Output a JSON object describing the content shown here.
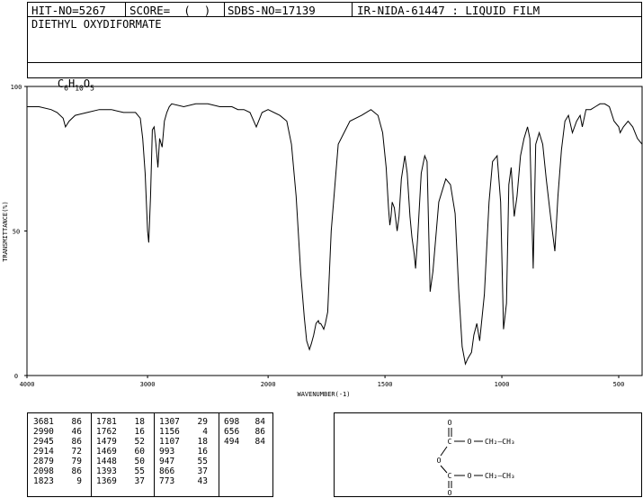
{
  "header": {
    "hit": "HIT-NO=5267",
    "score": "SCORE=  (  )",
    "sdbs": "SDBS-NO=17139",
    "ir": "IR-NIDA-61447 : LIQUID FILM"
  },
  "compound_name": "DIETHYL OXYDIFORMATE",
  "formula": {
    "c": "C",
    "c_sub": "6",
    "h": "H",
    "h_sub": "10",
    "o": "O",
    "o_sub": "5"
  },
  "peak_table": {
    "columns": [
      [
        [
          "3681",
          "86"
        ],
        [
          "2990",
          "46"
        ],
        [
          "2945",
          "86"
        ],
        [
          "2914",
          "72"
        ],
        [
          "2879",
          "79"
        ],
        [
          "2098",
          "86"
        ],
        [
          "1823",
          "9"
        ]
      ],
      [
        [
          "1781",
          "18"
        ],
        [
          "1762",
          "16"
        ],
        [
          "1479",
          "52"
        ],
        [
          "1469",
          "60"
        ],
        [
          "1448",
          "50"
        ],
        [
          "1393",
          "55"
        ],
        [
          "1369",
          "37"
        ]
      ],
      [
        [
          "1307",
          "29"
        ],
        [
          "1156",
          "4"
        ],
        [
          "1107",
          "18"
        ],
        [
          "993",
          "16"
        ],
        [
          "947",
          "55"
        ],
        [
          "866",
          "37"
        ],
        [
          "773",
          "43"
        ]
      ],
      [
        [
          "698",
          "84"
        ],
        [
          "656",
          "86"
        ],
        [
          "494",
          "84"
        ]
      ]
    ]
  },
  "structure": {
    "o_top": "O",
    "c_top": "C",
    "o_top_ester": "O",
    "chain_top": "CH₂—CH₃",
    "o_bridge": "O",
    "c_bottom": "C",
    "o_bottom_ester": "O",
    "chain_bottom": "CH₂—CH₃",
    "o_bottom": "O"
  },
  "chart_data": {
    "type": "line",
    "title": "",
    "xlabel": "WAVENUMBER(-1)",
    "ylabel": "TRANSMITTANCE(%)",
    "xlim": [
      4000,
      400
    ],
    "ylim": [
      0,
      100
    ],
    "x_ticks": [
      "4000",
      "3000",
      "2000",
      "1500",
      "1000",
      "500"
    ],
    "y_ticks": [
      "100",
      "50",
      "0"
    ],
    "grid": false,
    "series": [
      {
        "x": [
          4000,
          3900,
          3800,
          3750,
          3700,
          3681,
          3650,
          3600,
          3500,
          3400,
          3300,
          3200,
          3100,
          3060,
          3040,
          3020,
          3000,
          2990,
          2975,
          2960,
          2945,
          2930,
          2914,
          2900,
          2879,
          2860,
          2840,
          2820,
          2800,
          2700,
          2600,
          2500,
          2400,
          2300,
          2250,
          2200,
          2150,
          2098,
          2050,
          2000,
          1950,
          1920,
          1900,
          1880,
          1860,
          1845,
          1835,
          1823,
          1815,
          1805,
          1795,
          1785,
          1781,
          1775,
          1768,
          1762,
          1755,
          1745,
          1730,
          1700,
          1650,
          1600,
          1560,
          1530,
          1510,
          1495,
          1485,
          1479,
          1474,
          1469,
          1460,
          1448,
          1440,
          1430,
          1415,
          1405,
          1393,
          1385,
          1375,
          1369,
          1360,
          1345,
          1330,
          1320,
          1307,
          1295,
          1270,
          1240,
          1220,
          1200,
          1185,
          1170,
          1156,
          1145,
          1130,
          1120,
          1107,
          1095,
          1075,
          1055,
          1040,
          1020,
          1005,
          993,
          980,
          970,
          960,
          947,
          935,
          920,
          905,
          890,
          880,
          866,
          855,
          840,
          825,
          810,
          790,
          773,
          760,
          745,
          730,
          715,
          698,
          680,
          665,
          656,
          640,
          620,
          600,
          580,
          560,
          540,
          520,
          500,
          494,
          480,
          460,
          440,
          420,
          400
        ],
        "y": [
          93,
          93,
          92,
          91,
          89,
          86,
          88,
          90,
          91,
          92,
          92,
          91,
          91,
          89,
          82,
          70,
          50,
          46,
          62,
          85,
          86,
          80,
          72,
          82,
          79,
          88,
          91,
          93,
          94,
          93,
          94,
          94,
          93,
          93,
          92,
          92,
          91,
          86,
          91,
          92,
          90,
          88,
          80,
          62,
          35,
          20,
          12,
          9,
          11,
          14,
          18,
          19,
          18,
          18,
          17,
          16,
          18,
          22,
          50,
          80,
          88,
          90,
          92,
          90,
          84,
          72,
          58,
          52,
          55,
          60,
          58,
          50,
          55,
          68,
          76,
          70,
          55,
          48,
          42,
          37,
          48,
          70,
          76,
          74,
          29,
          36,
          60,
          68,
          66,
          56,
          30,
          10,
          4,
          6,
          8,
          14,
          18,
          12,
          28,
          60,
          74,
          76,
          60,
          16,
          25,
          66,
          72,
          55,
          62,
          76,
          82,
          86,
          82,
          37,
          80,
          84,
          80,
          68,
          54,
          43,
          62,
          78,
          88,
          90,
          84,
          88,
          90,
          86,
          92,
          92,
          93,
          94,
          94,
          93,
          88,
          86,
          84,
          86,
          88,
          86,
          82,
          80
        ]
      }
    ]
  }
}
